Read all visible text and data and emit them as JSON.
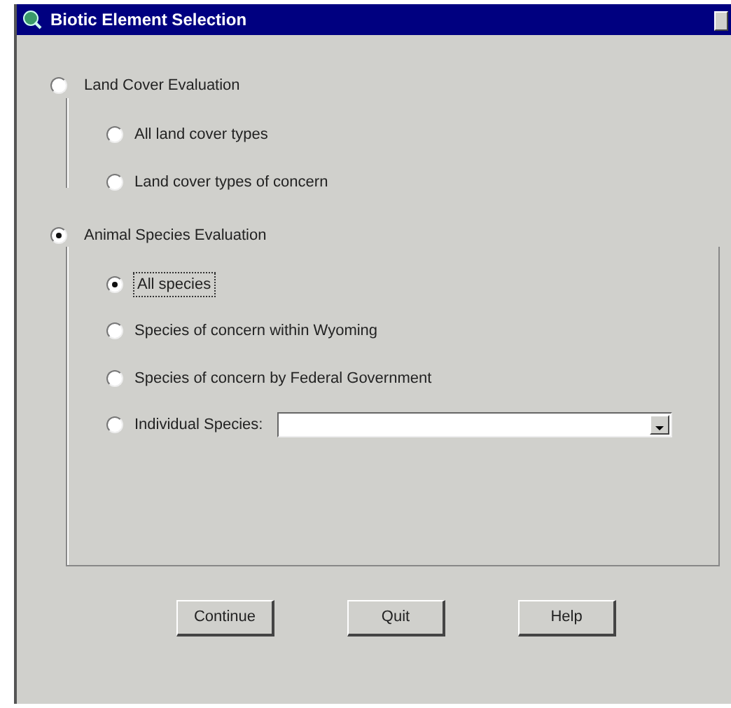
{
  "window": {
    "title": "Biotic Element Selection"
  },
  "groups": [
    {
      "label": "Land Cover Evaluation",
      "selected": false,
      "options": [
        {
          "kind": "radio",
          "label": "All land cover types",
          "selected": false,
          "focused": false
        },
        {
          "kind": "radio",
          "label": "Land cover types of concern",
          "selected": false,
          "focused": false
        }
      ]
    },
    {
      "label": "Animal Species Evaluation",
      "selected": true,
      "options": [
        {
          "kind": "radio",
          "label": "All species",
          "selected": true,
          "focused": true
        },
        {
          "kind": "radio",
          "label": "Species of concern within Wyoming",
          "selected": false,
          "focused": false
        },
        {
          "kind": "radio",
          "label": "Species of concern by Federal Government",
          "selected": false,
          "focused": false
        },
        {
          "kind": "dropdown",
          "label": "Individual Species:",
          "selected": false,
          "focused": false
        }
      ]
    }
  ],
  "buttons": [
    "Continue",
    "Quit",
    "Help"
  ]
}
